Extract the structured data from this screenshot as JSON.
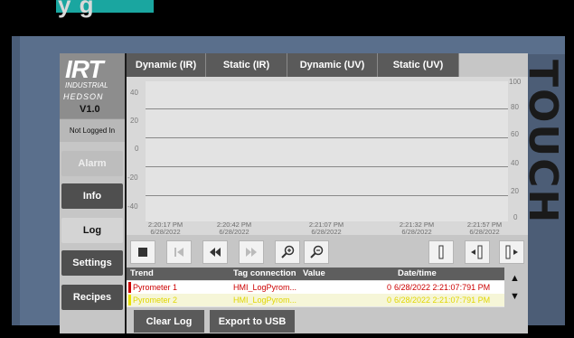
{
  "header": {
    "title_fragment": "y   g"
  },
  "side_label": "TOUCH",
  "logo": {
    "brand": "IRT",
    "sub": "INDUSTRIAL",
    "partner": "HEDSON",
    "version": "V1.0"
  },
  "login_status": "Not Logged In",
  "nav": {
    "alarm": "Alarm",
    "info": "Info",
    "log": "Log",
    "settings": "Settings",
    "recipes": "Recipes"
  },
  "tabs": [
    "Dynamic (IR)",
    "Static (IR)",
    "Dynamic (UV)",
    "Static (UV)"
  ],
  "chart_data": {
    "type": "line",
    "left_axis": {
      "ticks": [
        "40",
        "20",
        "0",
        "-20",
        "-40"
      ]
    },
    "right_axis": {
      "ticks": [
        "100",
        "80",
        "60",
        "40",
        "20",
        "0"
      ]
    },
    "x_labels": [
      {
        "time": "2:20:17 PM",
        "date": "6/28/2022"
      },
      {
        "time": "2:20:42 PM",
        "date": "6/28/2022"
      },
      {
        "time": "2:21:07 PM",
        "date": "6/28/2022"
      },
      {
        "time": "2:21:32 PM",
        "date": "6/28/2022"
      },
      {
        "time": "2:21:57 PM",
        "date": "6/28/2022"
      }
    ],
    "series": []
  },
  "toolbar_icons": [
    "stop-icon",
    "skip-back-icon",
    "rewind-icon",
    "fast-forward-icon",
    "zoom-in-icon",
    "zoom-out-icon",
    "ruler-icon",
    "ruler-left-icon",
    "ruler-right-icon"
  ],
  "table": {
    "headers": {
      "trend": "Trend",
      "tag": "Tag connection",
      "value": "Value",
      "datetime": "Date/time"
    },
    "rows": [
      {
        "trend": "Pyrometer 1",
        "tag": "HMI_LogPyrom...",
        "value": "0",
        "datetime": "6/28/2022 2:21:07:791 PM",
        "color": "#cc0000"
      },
      {
        "trend": "Pyrometer 2",
        "tag": "HMI_LogPyrom...",
        "value": "0",
        "datetime": "6/28/2022 2:21:07:791 PM",
        "color": "#e8e000"
      }
    ]
  },
  "actions": {
    "clear_log": "Clear Log",
    "export": "Export to USB"
  },
  "colors": {
    "accent": "#1aa6a0",
    "panel": "#5a6f8c",
    "dark_button": "#5a5a5a",
    "series1": "#cc0000",
    "series2": "#e8e000"
  }
}
